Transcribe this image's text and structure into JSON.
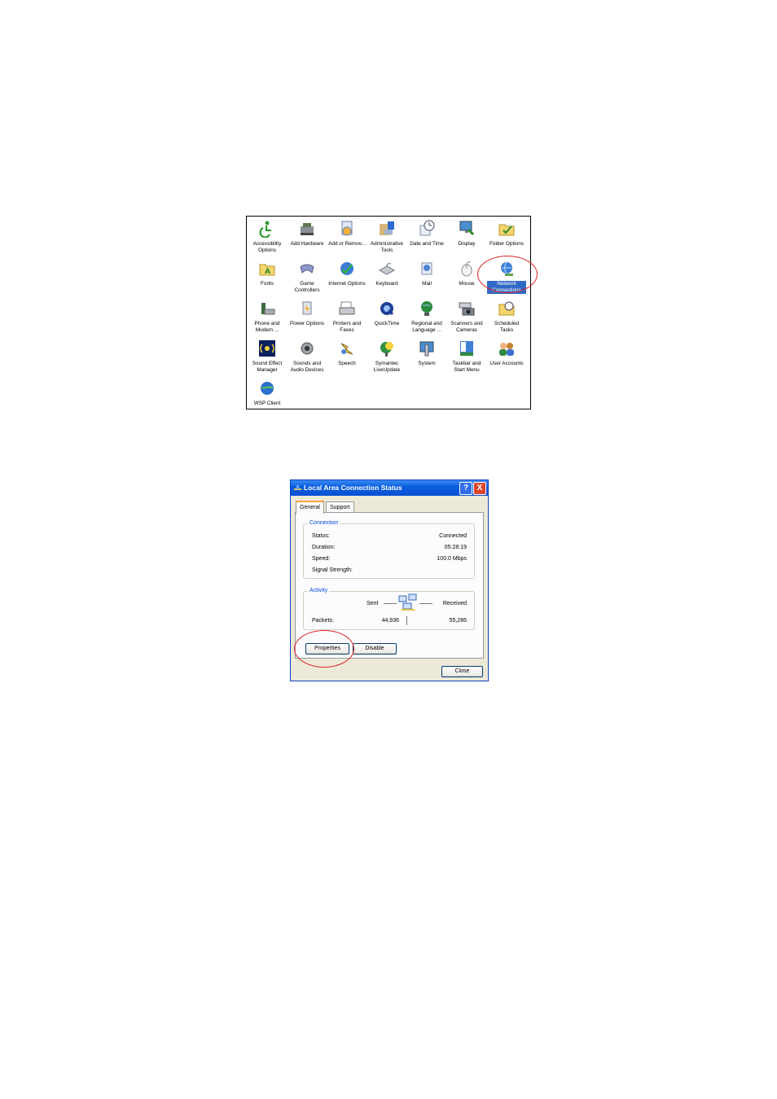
{
  "control_panel": {
    "items": [
      {
        "label": "Accessibility Options",
        "icon": "accessibility-icon"
      },
      {
        "label": "Add Hardware",
        "icon": "add-hardware-icon"
      },
      {
        "label": "Add or Remov...",
        "icon": "add-remove-programs-icon"
      },
      {
        "label": "Administrative Tools",
        "icon": "administrative-tools-icon"
      },
      {
        "label": "Date and Time",
        "icon": "date-time-icon"
      },
      {
        "label": "Display",
        "icon": "display-icon"
      },
      {
        "label": "Folder Options",
        "icon": "folder-options-icon"
      },
      {
        "label": "Fonts",
        "icon": "fonts-icon"
      },
      {
        "label": "Game Controllers",
        "icon": "game-controllers-icon"
      },
      {
        "label": "Internet Options",
        "icon": "internet-options-icon"
      },
      {
        "label": "Keyboard",
        "icon": "keyboard-icon"
      },
      {
        "label": "Mail",
        "icon": "mail-icon"
      },
      {
        "label": "Mouse",
        "icon": "mouse-icon"
      },
      {
        "label": "Network Connections",
        "icon": "network-connections-icon",
        "selected": true
      },
      {
        "label": "Phone and Modem ...",
        "icon": "phone-modem-icon"
      },
      {
        "label": "Power Options",
        "icon": "power-options-icon"
      },
      {
        "label": "Printers and Faxes",
        "icon": "printers-faxes-icon"
      },
      {
        "label": "QuickTime",
        "icon": "quicktime-icon"
      },
      {
        "label": "Regional and Language ...",
        "icon": "regional-language-icon"
      },
      {
        "label": "Scanners and Cameras",
        "icon": "scanners-cameras-icon"
      },
      {
        "label": "Scheduled Tasks",
        "icon": "scheduled-tasks-icon"
      },
      {
        "label": "Sound Effect Manager",
        "icon": "sound-effect-manager-icon"
      },
      {
        "label": "Sounds and Audio Devices",
        "icon": "sounds-audio-icon"
      },
      {
        "label": "Speech",
        "icon": "speech-icon"
      },
      {
        "label": "Symantec LiveUpdate",
        "icon": "symantec-liveupdate-icon"
      },
      {
        "label": "System",
        "icon": "system-icon"
      },
      {
        "label": "Taskbar and Start Menu",
        "icon": "taskbar-start-menu-icon"
      },
      {
        "label": "User Accounts",
        "icon": "user-accounts-icon"
      },
      {
        "label": "WSP Client",
        "icon": "wsp-client-icon"
      }
    ]
  },
  "dialog": {
    "title": "Local Area Connection Status",
    "help_button": "?",
    "close_x": "X",
    "tabs": [
      {
        "label": "General",
        "active": true
      },
      {
        "label": "Support",
        "active": false
      }
    ],
    "connection": {
      "legend": "Connection",
      "status_label": "Status:",
      "status_value": "Connected",
      "duration_label": "Duration:",
      "duration_value": "05:28:19",
      "speed_label": "Speed:",
      "speed_value": "100.0 Mbps",
      "signal_label": "Signal Strength:"
    },
    "activity": {
      "legend": "Activity",
      "sent_label": "Sent",
      "received_label": "Received",
      "packets_label": "Packets:",
      "packets_sent": "44,936",
      "packets_received": "55,286"
    },
    "properties_button": "Properties",
    "disable_button": "Disable",
    "close_button": "Close"
  },
  "colors": {
    "annotation": "#e02020",
    "selection": "#316ac5",
    "titlebar": "#0a5fe0"
  }
}
